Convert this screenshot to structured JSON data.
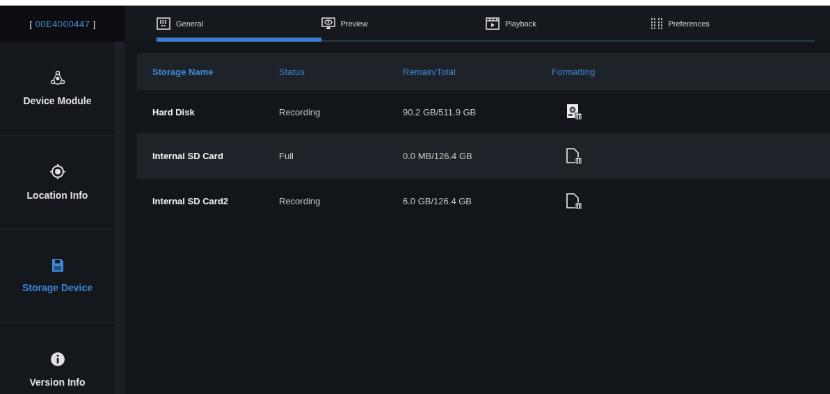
{
  "device_id": {
    "open": "[",
    "id": "00E4000447",
    "close": "]"
  },
  "tabs": [
    {
      "label": "General",
      "selected": true
    },
    {
      "label": "Preview",
      "selected": false
    },
    {
      "label": "Playback",
      "selected": false
    },
    {
      "label": "Preferences",
      "selected": false
    }
  ],
  "sidebar": {
    "items": [
      {
        "label": "Device Module",
        "selected": false
      },
      {
        "label": "Location Info",
        "selected": false
      },
      {
        "label": "Storage Device",
        "selected": true
      },
      {
        "label": "Version Info",
        "selected": false
      }
    ]
  },
  "table": {
    "columns": [
      "Storage Name",
      "Status",
      "Remain/Total",
      "Formatting"
    ],
    "rows": [
      {
        "name": "Hard Disk",
        "status": "Recording",
        "capacity": "90.2 GB/511.9 GB",
        "kind": "disk"
      },
      {
        "name": "Internal SD Card",
        "status": "Full",
        "capacity": "0.0 MB/126.4 GB",
        "kind": "card"
      },
      {
        "name": "Internal SD Card2",
        "status": "Recording",
        "capacity": "6.0 GB/126.4 GB",
        "kind": "card"
      }
    ]
  }
}
